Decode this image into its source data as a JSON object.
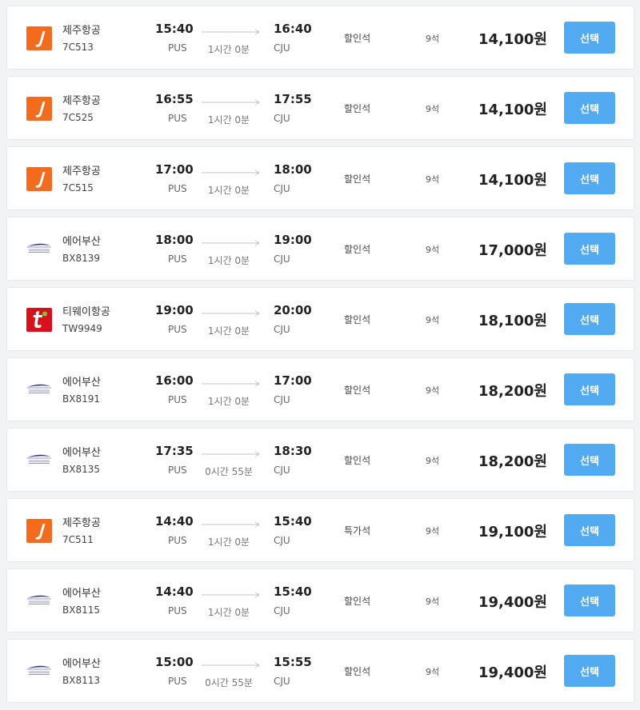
{
  "flights": [
    {
      "airline": "제주항공",
      "logo": "jeju-air-logo-icon",
      "flight_no": "7C513",
      "dep_time": "15:40",
      "dep_code": "PUS",
      "duration": "1시간 0분",
      "arr_time": "16:40",
      "arr_code": "CJU",
      "seat_class": "할인석",
      "seats": "9석",
      "price": "14,100원",
      "button": "선택"
    },
    {
      "airline": "제주항공",
      "logo": "jeju-air-logo-icon",
      "flight_no": "7C525",
      "dep_time": "16:55",
      "dep_code": "PUS",
      "duration": "1시간 0분",
      "arr_time": "17:55",
      "arr_code": "CJU",
      "seat_class": "할인석",
      "seats": "9석",
      "price": "14,100원",
      "button": "선택"
    },
    {
      "airline": "제주항공",
      "logo": "jeju-air-logo-icon",
      "flight_no": "7C515",
      "dep_time": "17:00",
      "dep_code": "PUS",
      "duration": "1시간 0분",
      "arr_time": "18:00",
      "arr_code": "CJU",
      "seat_class": "할인석",
      "seats": "9석",
      "price": "14,100원",
      "button": "선택"
    },
    {
      "airline": "에어부산",
      "logo": "air-busan-logo-icon",
      "flight_no": "BX8139",
      "dep_time": "18:00",
      "dep_code": "PUS",
      "duration": "1시간 0분",
      "arr_time": "19:00",
      "arr_code": "CJU",
      "seat_class": "할인석",
      "seats": "9석",
      "price": "17,000원",
      "button": "선택"
    },
    {
      "airline": "티웨이항공",
      "logo": "tway-air-logo-icon",
      "flight_no": "TW9949",
      "dep_time": "19:00",
      "dep_code": "PUS",
      "duration": "1시간 0분",
      "arr_time": "20:00",
      "arr_code": "CJU",
      "seat_class": "할인석",
      "seats": "9석",
      "price": "18,100원",
      "button": "선택"
    },
    {
      "airline": "에어부산",
      "logo": "air-busan-logo-icon",
      "flight_no": "BX8191",
      "dep_time": "16:00",
      "dep_code": "PUS",
      "duration": "1시간 0분",
      "arr_time": "17:00",
      "arr_code": "CJU",
      "seat_class": "할인석",
      "seats": "9석",
      "price": "18,200원",
      "button": "선택"
    },
    {
      "airline": "에어부산",
      "logo": "air-busan-logo-icon",
      "flight_no": "BX8135",
      "dep_time": "17:35",
      "dep_code": "PUS",
      "duration": "0시간 55분",
      "arr_time": "18:30",
      "arr_code": "CJU",
      "seat_class": "할인석",
      "seats": "9석",
      "price": "18,200원",
      "button": "선택"
    },
    {
      "airline": "제주항공",
      "logo": "jeju-air-logo-icon",
      "flight_no": "7C511",
      "dep_time": "14:40",
      "dep_code": "PUS",
      "duration": "1시간 0분",
      "arr_time": "15:40",
      "arr_code": "CJU",
      "seat_class": "특가석",
      "seats": "9석",
      "price": "19,100원",
      "button": "선택"
    },
    {
      "airline": "에어부산",
      "logo": "air-busan-logo-icon",
      "flight_no": "BX8115",
      "dep_time": "14:40",
      "dep_code": "PUS",
      "duration": "1시간 0분",
      "arr_time": "15:40",
      "arr_code": "CJU",
      "seat_class": "할인석",
      "seats": "9석",
      "price": "19,400원",
      "button": "선택"
    },
    {
      "airline": "에어부산",
      "logo": "air-busan-logo-icon",
      "flight_no": "BX8113",
      "dep_time": "15:00",
      "dep_code": "PUS",
      "duration": "0시간 55분",
      "arr_time": "15:55",
      "arr_code": "CJU",
      "seat_class": "할인석",
      "seats": "9석",
      "price": "19,400원",
      "button": "선택"
    }
  ],
  "colors": {
    "button_bg": "#52aaf0",
    "jeju_orange": "#f26c1f",
    "tway_red": "#d7111b",
    "air_busan_blue": "#2a2f8f"
  }
}
